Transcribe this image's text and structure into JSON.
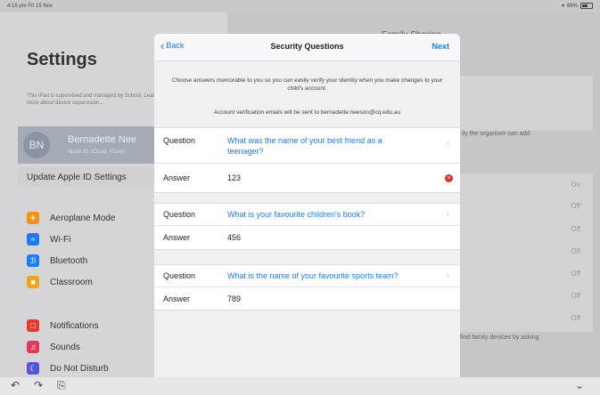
{
  "status_bar": {
    "time": "4:16 pm  Fri 15 Nov",
    "battery": "66%"
  },
  "background": {
    "settings_title": "Settings",
    "supervised_text": "This iPad is supervised and managed by School. Learn more about device supervision...",
    "profile": {
      "initials": "BN",
      "name": "Bernadette Nee",
      "sub": "Apple ID, iCloud, iTunes"
    },
    "update_label": "Update Apple ID Settings",
    "menu": [
      {
        "label": "Aeroplane Mode",
        "icon": "airplane-icon",
        "color": "#f0901e"
      },
      {
        "label": "Wi-Fi",
        "icon": "wifi-icon",
        "color": "#1a7cf0"
      },
      {
        "label": "Bluetooth",
        "icon": "bluetooth-icon",
        "color": "#1a7cf0"
      },
      {
        "label": "Classroom",
        "icon": "classroom-icon",
        "color": "#f0a21e"
      }
    ],
    "menu2": [
      {
        "label": "Notifications",
        "icon": "notifications-icon",
        "color": "#e23b30"
      },
      {
        "label": "Sounds",
        "icon": "sounds-icon",
        "color": "#e23b5a"
      },
      {
        "label": "Do Not Disturb",
        "icon": "moon-icon",
        "color": "#5a52d6"
      }
    ],
    "right_header": "Family Sharing",
    "right_note": "ily the organiser can add",
    "right_offs": [
      "On",
      "Off",
      "Off",
      "Off",
      "Off",
      "Off",
      "Off"
    ],
    "right_footer": "r, find family devices by asking"
  },
  "modal": {
    "back_label": "Back",
    "title": "Security Questions",
    "next_label": "Next",
    "intro": "Choose answers memorable to you so you can easily verify your identity when you make changes to your child's account.",
    "verify_note": "Account verification emails will be sent to bernadette.neeson@cq.edu.au",
    "question_key": "Question",
    "answer_key": "Answer",
    "items": [
      {
        "question": "What was the name of your best friend as a teenager?",
        "answer": "123"
      },
      {
        "question": "What is your favourite children's book?",
        "answer": "456"
      },
      {
        "question": "What is the name of your favourite sports team?",
        "answer": "789"
      }
    ]
  },
  "toolbar": {
    "undo": "undo-icon",
    "redo": "redo-icon",
    "paste": "clipboard-icon",
    "collapse": "chevron-down-icon"
  }
}
